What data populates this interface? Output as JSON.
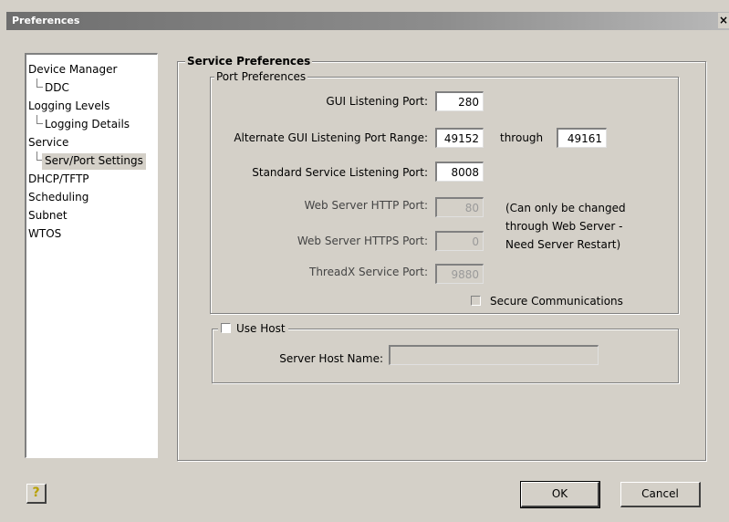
{
  "window": {
    "title": "Preferences",
    "close_glyph": "×"
  },
  "tree": {
    "items": [
      {
        "label": "Device Manager",
        "level": 0
      },
      {
        "label": "DDC",
        "level": 1
      },
      {
        "label": "Logging Levels",
        "level": 0
      },
      {
        "label": "Logging Details",
        "level": 1
      },
      {
        "label": "Service",
        "level": 0
      },
      {
        "label": "Serv/Port Settings",
        "level": 1,
        "selected": true
      },
      {
        "label": "DHCP/TFTP",
        "level": 0
      },
      {
        "label": "Scheduling",
        "level": 0
      },
      {
        "label": "Subnet",
        "level": 0
      },
      {
        "label": "WTOS",
        "level": 0
      }
    ]
  },
  "service_preferences": {
    "title": "Service Preferences",
    "port_preferences": {
      "title": "Port Preferences",
      "gui_port_label": "GUI Listening Port:",
      "gui_port_value": "280",
      "alt_range_label": "Alternate GUI Listening Port Range:",
      "alt_range_from": "49152",
      "through_label": "through",
      "alt_range_to": "49161",
      "std_port_label": "Standard Service Listening Port:",
      "std_port_value": "8008",
      "http_port_label": "Web Server HTTP Port:",
      "http_port_value": "80",
      "https_port_label": "Web Server HTTPS Port:",
      "https_port_value": "0",
      "threadx_label": "ThreadX Service Port:",
      "threadx_value": "9880",
      "note_line1": "(Can only be changed",
      "note_line2": "through Web Server -",
      "note_line3": "Need Server Restart)",
      "secure_label": "Secure Communications",
      "secure_checked": false
    },
    "use_host": {
      "label": "Use Host",
      "checked": false,
      "server_host_label": "Server Host Name:",
      "server_host_value": ""
    }
  },
  "buttons": {
    "ok": "OK",
    "cancel": "Cancel",
    "help_glyph": "?"
  },
  "colors": {
    "dialog_bg": "#d4d0c8",
    "title_bar": "#7a7a7a"
  },
  "icons": {
    "help": "help-icon",
    "close": "close-icon"
  }
}
